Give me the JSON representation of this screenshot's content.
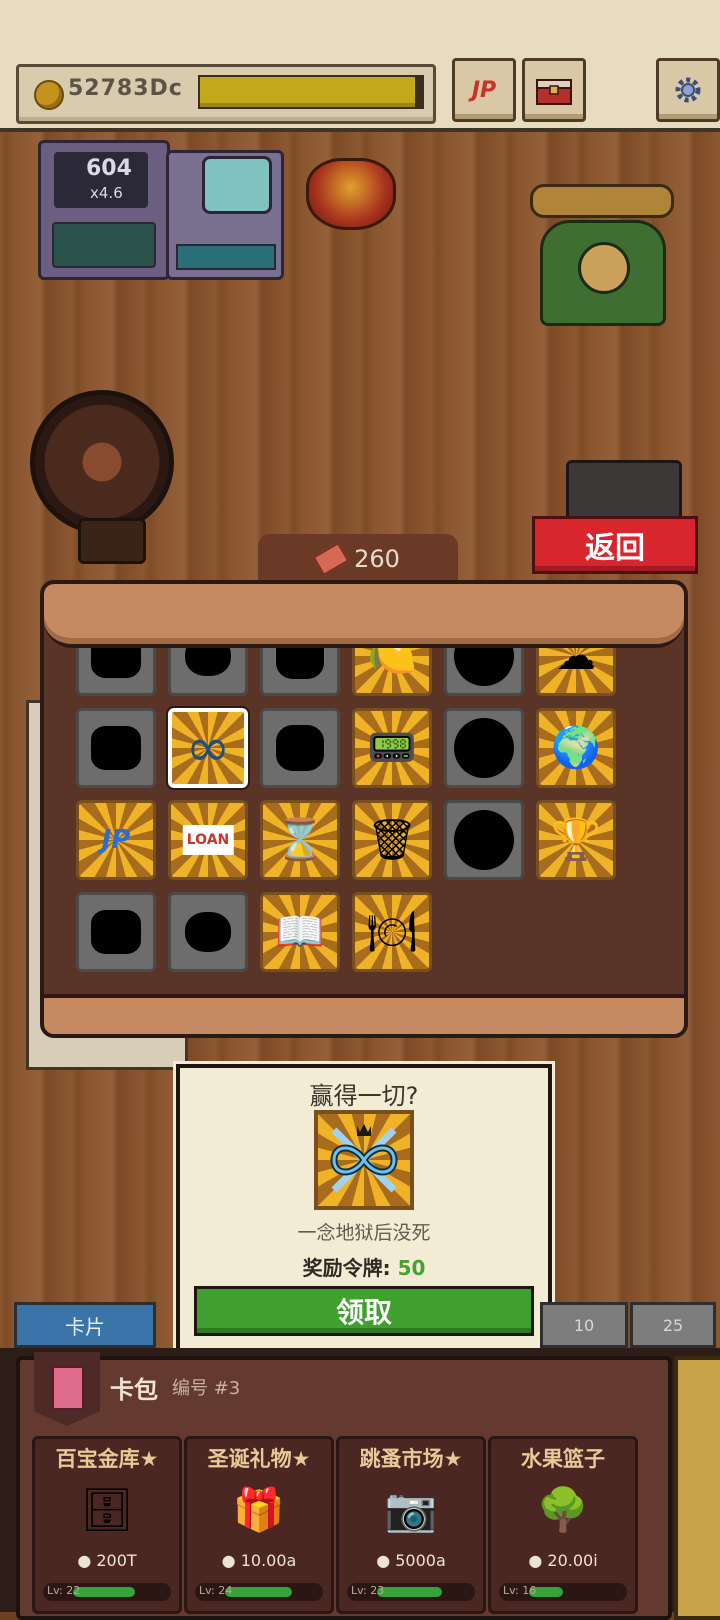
{
  "header": {
    "coins": "52783Dc",
    "progress_fraction": 0.97,
    "jp_label": "JP"
  },
  "device": {
    "counter_value": "604",
    "multiplier": "x4.6"
  },
  "back_button": {
    "label": "返回"
  },
  "tickets": {
    "count": "260"
  },
  "collection": {
    "cards": [
      {
        "state": "locked",
        "icon": "silhouette"
      },
      {
        "state": "locked",
        "icon": "silhouette"
      },
      {
        "state": "locked",
        "icon": "silhouette"
      },
      {
        "state": "found",
        "icon": "fruit-icon"
      },
      {
        "state": "locked",
        "icon": "silhouette"
      },
      {
        "state": "found",
        "icon": "pillow-icon"
      },
      {
        "state": "locked",
        "icon": "silhouette"
      },
      {
        "state": "selected",
        "icon": "infinity-icon"
      },
      {
        "state": "locked",
        "icon": "silhouette"
      },
      {
        "state": "found",
        "icon": "devices-icon"
      },
      {
        "state": "locked",
        "icon": "silhouette"
      },
      {
        "state": "found",
        "icon": "globe-icon"
      },
      {
        "state": "found",
        "icon": "jp-icon"
      },
      {
        "state": "found",
        "icon": "loan-icon",
        "text": "LOAN"
      },
      {
        "state": "found",
        "icon": "hourglass-icon"
      },
      {
        "state": "found",
        "icon": "trash-can-icon"
      },
      {
        "state": "locked",
        "icon": "silhouette"
      },
      {
        "state": "found",
        "icon": "trophy-icon"
      },
      {
        "state": "locked",
        "icon": "silhouette"
      },
      {
        "state": "locked",
        "icon": "silhouette"
      },
      {
        "state": "found",
        "icon": "book-icon"
      },
      {
        "state": "found",
        "icon": "plates-icon"
      }
    ]
  },
  "popup": {
    "title": "赢得一切?",
    "description": "一念地狱后没死",
    "reward_label": "奖励令牌: ",
    "reward_value": "50",
    "claim_label": "领取"
  },
  "tabs": {
    "cards": "卡片",
    "ten": "10",
    "twenty_five": "25"
  },
  "pack_shelf": {
    "title": "卡包",
    "number": "编号 #3",
    "packs": [
      {
        "name": "百宝金库★",
        "icon": "vault-icon",
        "price": "200T",
        "level": "Lv: 22",
        "level_fraction": 0.65
      },
      {
        "name": "圣诞礼物★",
        "icon": "gift-icon",
        "price": "10.00a",
        "level": "Lv: 24",
        "level_fraction": 0.7
      },
      {
        "name": "跳蚤市场★",
        "icon": "camera-icon",
        "price": "5000a",
        "level": "Lv: 23",
        "level_fraction": 0.68
      },
      {
        "name": "水果篮子",
        "icon": "bush-icon",
        "price": "20.00i",
        "level": "Lv: 16",
        "level_fraction": 0.35
      }
    ]
  },
  "colors": {
    "back_red": "#d8262f",
    "claim_green": "#3f9f2f",
    "tab_blue": "#3a74a8",
    "reward_green": "#48a131"
  }
}
